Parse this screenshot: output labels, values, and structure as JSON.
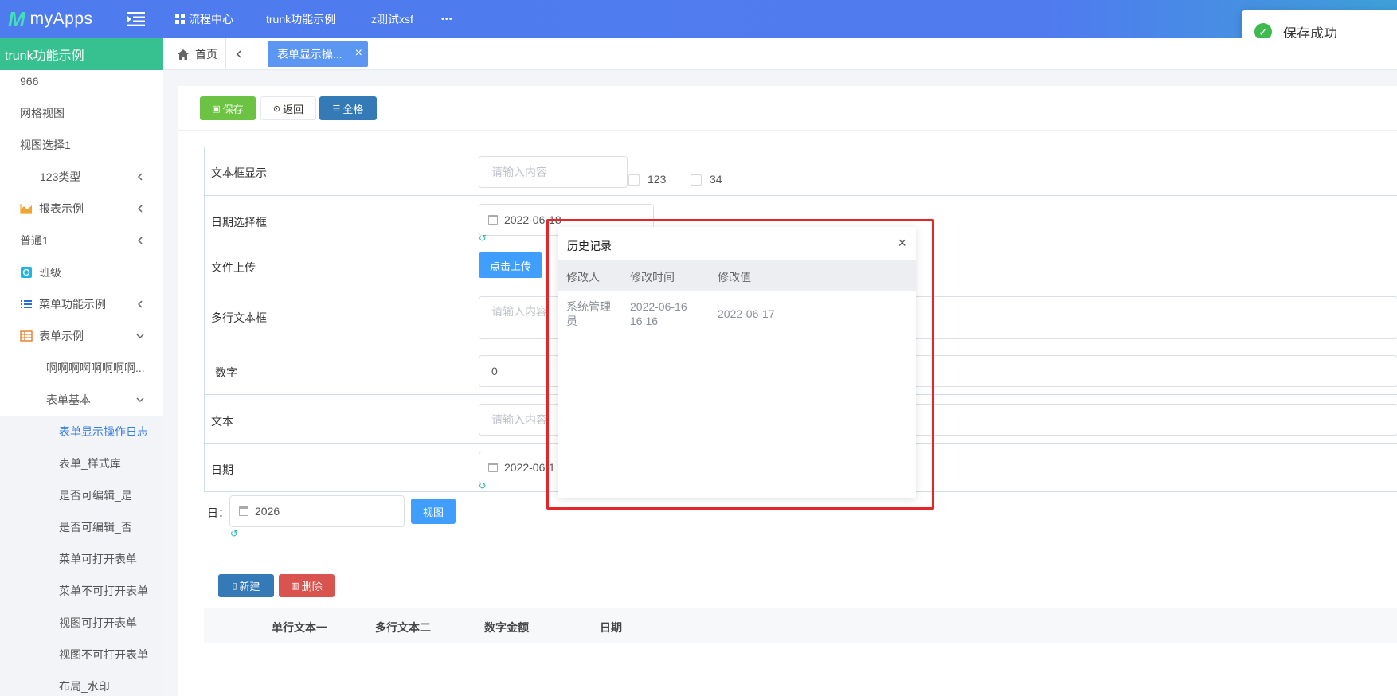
{
  "header": {
    "app_name": "myApps",
    "nav": [
      "流程中心",
      "trunk功能示例",
      "z测试xsf",
      "•••"
    ]
  },
  "toast": {
    "message": "保存成功"
  },
  "sidebar": {
    "title": "trunk功能示例",
    "items": [
      "966",
      "网格视图",
      "视图选择1",
      "123类型",
      "报表示例",
      "普通1",
      "班级",
      "菜单功能示例",
      "表单示例",
      "啊啊啊啊啊啊啊啊...",
      "表单基本",
      "表单显示操作日志",
      "表单_样式库",
      "是否可编辑_是",
      "是否可编辑_否",
      "菜单可打开表单",
      "菜单不可打开表单",
      "视图可打开表单",
      "视图不可打开表单",
      "布局_水印"
    ]
  },
  "tabs": {
    "home": "首页",
    "active": "表单显示操...",
    "close": "×"
  },
  "toolbar": {
    "save": "保存",
    "back": "返回",
    "grid": "全格"
  },
  "form": {
    "rows": [
      {
        "label": "文本框显示",
        "placeholder": "请输入内容",
        "options": [
          "123",
          "34"
        ]
      },
      {
        "label": "日期选择框",
        "value": "2022-06-18"
      },
      {
        "label": "文件上传",
        "button": "点击上传"
      },
      {
        "label": "多行文本框",
        "placeholder": "请输入内容"
      },
      {
        "label": "数字",
        "value": "0"
      },
      {
        "label": "文本",
        "placeholder": "请输入内容"
      },
      {
        "label": "日期",
        "value": "2022-06-1"
      }
    ],
    "filter": {
      "label": "日：",
      "value": "2026",
      "button": "视图"
    }
  },
  "subtable": {
    "new": "新建",
    "delete": "删除",
    "columns": [
      "单行文本一",
      "多行文本二",
      "数字金额",
      "日期"
    ]
  },
  "history": {
    "title": "历史记录",
    "close": "×",
    "columns": [
      "修改人",
      "修改时间",
      "修改值"
    ],
    "rows": [
      {
        "user_l1": "系统管理",
        "user_l2": "员",
        "time_l1": "2022-06-16",
        "time_l2": "16:16",
        "value": "2022-06-17"
      }
    ]
  },
  "colors": {
    "topbar": "#4e7cef",
    "sidebar_header": "#37c090",
    "save_button": "#6cc243",
    "grid_button": "#337ab7",
    "upload_button": "#409eff",
    "delete_button": "#d9534f",
    "highlight_box": "#e4262b"
  }
}
